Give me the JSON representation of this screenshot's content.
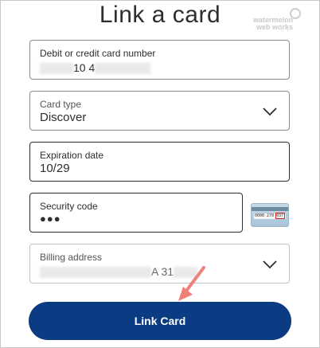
{
  "header": {
    "title": "Link a card"
  },
  "watermark": {
    "line1": "watermelon",
    "line2": "web works"
  },
  "form": {
    "card_number": {
      "label": "Debit or credit card number",
      "value": "10 4"
    },
    "card_type": {
      "label": "Card type",
      "value": "Discover"
    },
    "expiration": {
      "label": "Expiration date",
      "value": "10/29"
    },
    "security_code": {
      "label": "Security code",
      "value": "●●●"
    },
    "billing_address": {
      "label": "Billing address",
      "value": "A 31"
    }
  },
  "card_icon": {
    "numbers": "0000 270 037"
  },
  "actions": {
    "link_card_label": "Link Card"
  },
  "colors": {
    "primary": "#0b3b82",
    "arrow": "#f2807a"
  }
}
